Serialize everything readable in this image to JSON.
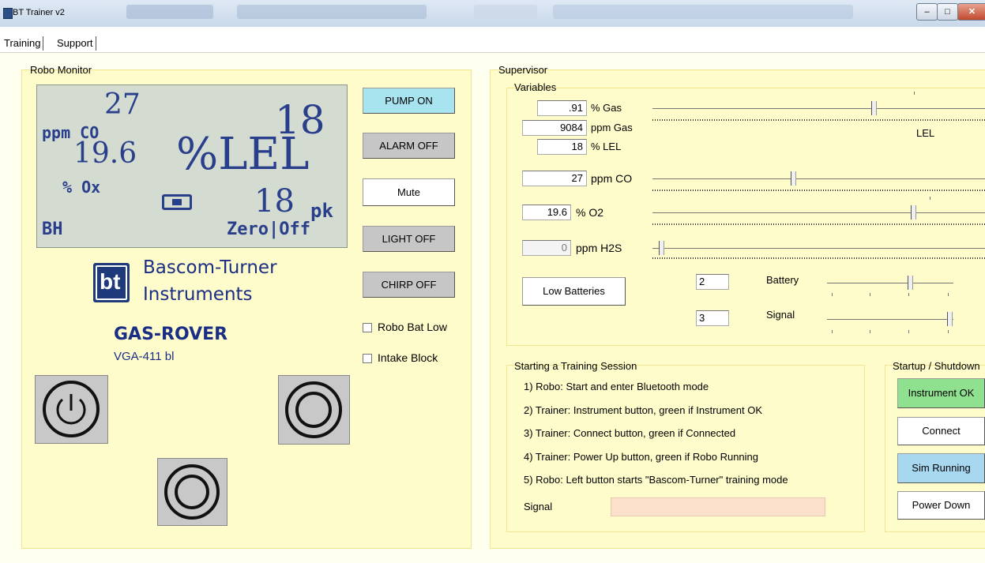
{
  "window": {
    "title": "BT Trainer v2"
  },
  "tabs": [
    {
      "label": "Training"
    },
    {
      "label": "Support"
    }
  ],
  "robo_monitor": {
    "title": "Robo Monitor",
    "lcd": {
      "co_value": "27",
      "co_unit": "ppm CO",
      "lel_value": "18",
      "lel_unit": "%LEL",
      "o2_value": "19.6",
      "o2_unit": "% Ox",
      "peak_value": "18",
      "peak_unit": "pk",
      "status_left": "BH",
      "status_right": "Zero|Off"
    },
    "brand": {
      "line1": "Bascom-Turner",
      "line2": "Instruments",
      "logo_text": "bt"
    },
    "product": "GAS-ROVER",
    "model": "VGA-411 bl",
    "buttons": {
      "pump": "PUMP ON",
      "alarm": "ALARM OFF",
      "mute": "Mute",
      "light": "LIGHT OFF",
      "chirp": "CHIRP OFF"
    },
    "checkboxes": {
      "robo_bat_low": "Robo Bat Low",
      "intake_block": "Intake Block"
    }
  },
  "supervisor": {
    "title": "Supervisor",
    "variables_title": "Variables",
    "gas_pct": {
      "value": ".91",
      "unit": "% Gas"
    },
    "gas_ppm": {
      "value": "9084",
      "unit": "ppm Gas"
    },
    "lel_pct": {
      "value": "18",
      "unit": "% LEL"
    },
    "lel_scale_label": "LEL",
    "co": {
      "value": "27",
      "unit": "ppm CO"
    },
    "o2": {
      "value": "19.6",
      "unit": "% O2"
    },
    "h2s": {
      "value": "0",
      "unit": "ppm H2S"
    },
    "low_batteries_button": "Low Batteries",
    "battery": {
      "value": "2",
      "label": "Battery"
    },
    "signal": {
      "value": "3",
      "label": "Signal"
    }
  },
  "training_session": {
    "title": "Starting a Training Session",
    "steps": [
      "1) Robo: Start and enter Bluetooth mode",
      "2) Trainer: Instrument button, green if Instrument OK",
      "3) Trainer: Connect button, green if Connected",
      "4) Trainer: Power Up button, green if Robo Running",
      "5) Robo: Left button starts \"Bascom-Turner\" training mode"
    ],
    "signal_label": "Signal"
  },
  "startup": {
    "title": "Startup / Shutdown",
    "instrument_ok": "Instrument OK",
    "connect": "Connect",
    "sim_running": "Sim Running",
    "power_down": "Power Down"
  },
  "colors": {
    "panel_bg": "#fffccc",
    "lcd_bg": "#d4dbd0",
    "lcd_text": "#2a3f8c",
    "instrument_ok": "#8fe08f",
    "sim_running": "#a8d7f0",
    "pump_on": "#a8e4f0",
    "signal_bar": "#fbe0cc"
  }
}
